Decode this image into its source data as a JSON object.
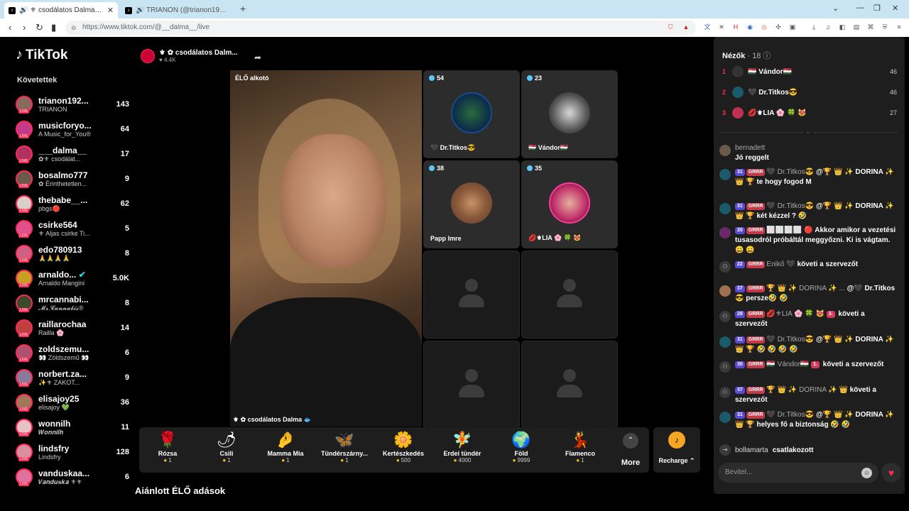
{
  "browser": {
    "tabs": [
      {
        "title": "🔊 ⚜ csodálatos Dalma🐟 🌎",
        "active": true
      },
      {
        "title": "🔊 TRIANON (@trianon1920jun4) É",
        "active": false
      }
    ],
    "url": "https://www.tiktok.com/@__dalma__/live"
  },
  "sidebar": {
    "brand": "TikTok",
    "header": "Követettek",
    "items": [
      {
        "name": "trianon192...",
        "sub": "TRIANON",
        "count": "143"
      },
      {
        "name": "musicforyo...",
        "sub": "A Music_for_You®",
        "count": "64"
      },
      {
        "name": "___dalma__",
        "sub": "✿⚜ csodálat...",
        "count": "17"
      },
      {
        "name": "bosalmo777",
        "sub": "✿ Érinthetetlen...",
        "count": "9"
      },
      {
        "name": "thebabe__...",
        "sub": "pbgs🔴",
        "count": "62"
      },
      {
        "name": "csirke564",
        "sub": "⚜ Aljas csirke Ti...",
        "count": "5"
      },
      {
        "name": "edo780913",
        "sub": "🙏🙏🙏🙏",
        "count": "8"
      },
      {
        "name": "arnaldo...",
        "sub": "Arnaldo Mangini",
        "count": "5.0K"
      },
      {
        "name": "mrcannabi...",
        "sub": "𝓜𝓻.𝓒𝓪𝓷𝓷𝓪𝓫𝓲𝓼®",
        "count": "8"
      },
      {
        "name": "raillarochaa",
        "sub": "Railla 🌸",
        "count": "14"
      },
      {
        "name": "zoldszemu...",
        "sub": "👀 Zöldszemű 👀",
        "count": "6"
      },
      {
        "name": "norbert.za...",
        "sub": "✨⚜ ZAKOT...",
        "count": "9"
      },
      {
        "name": "elisajoy25",
        "sub": "elisajoy 💚",
        "count": "36"
      },
      {
        "name": "wonnilh",
        "sub": "𝑾𝒐𝒏𝒏𝒊𝒍𝒉",
        "count": "11"
      },
      {
        "name": "lindsfry",
        "sub": "Lindsfry",
        "count": "128"
      },
      {
        "name": "vanduskaa...",
        "sub": "𝑽𝒂𝒏𝒅𝒖𝒔𝒌𝒂 ⚜⚜",
        "count": "6"
      }
    ]
  },
  "stream": {
    "host_title": "⚜ ✿ csodálatos Dalm...",
    "host_viewers": "4.4K",
    "live_label": "ÉLŐ alkotó",
    "host_name": "⚜ ✿ csodálatos Dalma 🐟",
    "guests": [
      {
        "count": "54",
        "name": "🖤 Dr.Titkos😎"
      },
      {
        "count": "23",
        "name": "🇭🇺 Vándor🇭🇺"
      },
      {
        "count": "38",
        "name": "Papp Imre"
      },
      {
        "count": "35",
        "name": "💋⚜LIA 🌸 🍀 😻"
      }
    ]
  },
  "gifts": {
    "items": [
      {
        "icon": "🌹",
        "name": "Rózsa",
        "price": "1"
      },
      {
        "icon": "🌶",
        "name": "Csili",
        "price": "1"
      },
      {
        "icon": "🤌",
        "name": "Mamma Mia",
        "price": "1"
      },
      {
        "icon": "🦋",
        "name": "Tündérszárny...",
        "price": "1"
      },
      {
        "icon": "🌼",
        "name": "Kertészkedés",
        "price": "500"
      },
      {
        "icon": "🧚",
        "name": "Erdei tündér",
        "price": "4000"
      },
      {
        "icon": "🌍",
        "name": "Föld",
        "price": "9999"
      },
      {
        "icon": "💃",
        "name": "Flamenco",
        "price": "1"
      }
    ],
    "more": "More",
    "recharge": "Recharge ⌃"
  },
  "recommend_label": "Ajánlott ÉLŐ adások",
  "viewers": {
    "title": "Nézők",
    "count": "· 18",
    "top": [
      {
        "rank": "1",
        "name": "🇭🇺 Vándor🇭🇺",
        "score": "46"
      },
      {
        "rank": "2",
        "name": "🖤 Dr.Titkos😎",
        "score": "46"
      },
      {
        "rank": "3",
        "name": "💋⚜LIA 🌸 🍀 😻",
        "score": "27"
      }
    ]
  },
  "chat": [
    {
      "user": "bernadett",
      "text": "Jó reggelt"
    },
    {
      "lvl": "31",
      "user": "🖤 Dr.Titkos😎",
      "text": "@🏆 👑 ✨ DORINA ✨ 👑 🏆 te hogy fogod M"
    },
    {
      "lvl": "31",
      "user": "🖤 Dr.Titkos😎",
      "text": "@🏆 👑 ✨ DORINA ✨ 👑 🏆 két kézzel ? 🤣"
    },
    {
      "lvl": "20",
      "user": "⬜⬜⬜⬜ 🔴",
      "text": "Akkor amikor a vezetési tusasodról próbáltál meggyőzni. Ki is vágtam. 😀 😀"
    },
    {
      "lvl": "22",
      "user": "Enikő 🖤",
      "text": "követi a szervezőt"
    },
    {
      "lvl": "37",
      "user": "🏆 👑 ✨ DORINA ✨ ...",
      "text": "@🖤 Dr.Titkos😎 persze🤣 🤣"
    },
    {
      "lvl": "28",
      "user": "💋⚜LIA 🌸 🍀 😻",
      "text": "követi a szervezőt"
    },
    {
      "lvl": "31",
      "user": "🖤 Dr.Titkos😎",
      "text": "@🏆 👑 ✨ DORINA ✨ 👑 🏆 🤣 🤣 🤣 🤣"
    },
    {
      "lvl": "30",
      "user": "🇭🇺 Vándor🇭🇺",
      "text": "követi a szervezőt"
    },
    {
      "lvl": "37",
      "user": "🏆 👑 ✨ DORINA ✨ 👑",
      "text": "követi a szervezőt"
    },
    {
      "lvl": "31",
      "user": "🖤 Dr.Titkos😎",
      "text": "@🏆 👑 ✨ DORINA ✨ 👑 🏆 helyes fő a biztonság 🤣 🤣"
    }
  ],
  "joined": {
    "user": "bollamarta",
    "text": "csatlakozott"
  },
  "input_placeholder": "Bevitel..."
}
